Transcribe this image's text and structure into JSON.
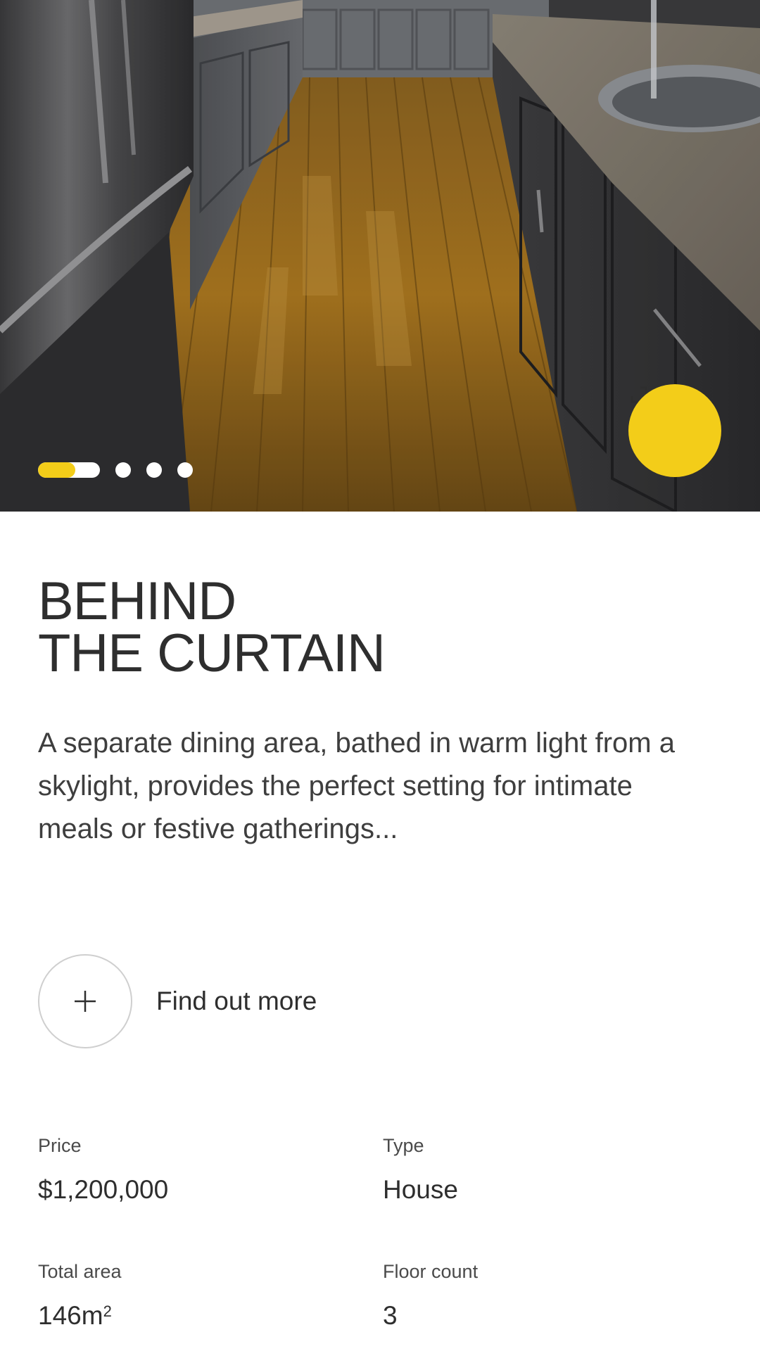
{
  "hero": {
    "image_alt": "Kitchen with wooden floor, grey cabinets and granite countertops",
    "carousel": {
      "total": 4,
      "active_index": 0,
      "active_progress": 0.6,
      "accent": "#f3cd19"
    },
    "fullscreen_icon": "expand-icon"
  },
  "listing": {
    "title_line1": "BEHIND",
    "title_line2": "THE CURTAIN",
    "description": "A separate dining area, bathed in warm light from a skylight, provides the perfect setting for intimate meals or festive gatherings...",
    "more_label": "Find out more",
    "more_icon": "plus-icon"
  },
  "specs": {
    "price_label": "Price",
    "price_value": "$1,200,000",
    "type_label": "Type",
    "type_value": "House",
    "area_label": "Total area",
    "area_value": "146m",
    "area_unit_sup": "2",
    "floors_label": "Floor count",
    "floors_value": "3"
  },
  "colors": {
    "accent": "#f3cd19",
    "text": "#2e2e2e"
  }
}
